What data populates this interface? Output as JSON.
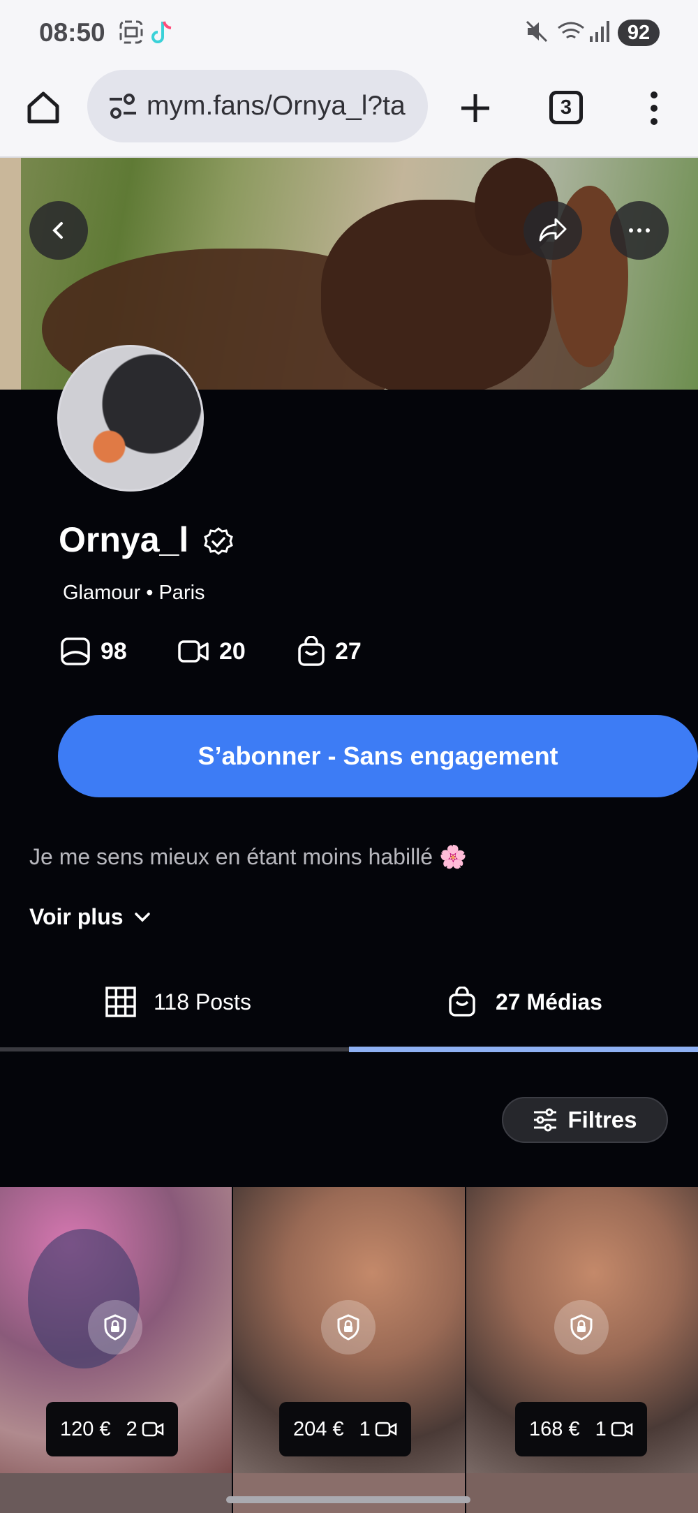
{
  "status_bar": {
    "time": "08:50",
    "battery": "92",
    "icons": [
      "screenshot-icon",
      "tiktok-icon",
      "mute-icon",
      "wifi-icon",
      "signal-icon"
    ]
  },
  "browser": {
    "url": "mym.fans/Ornya_l?ta",
    "tab_count": "3",
    "icons": [
      "home-icon",
      "site-settings-icon",
      "new-tab-icon",
      "tab-switcher-icon",
      "menu-icon"
    ]
  },
  "profile": {
    "username": "Ornya_l",
    "subtitle": "Glamour • Paris",
    "stats": {
      "photos": "98",
      "videos": "20",
      "medias": "27"
    },
    "subscribe_label": "S’abonner - Sans engagement",
    "bio": "Je me sens mieux en étant moins habillé 🌸",
    "more_label": "Voir plus"
  },
  "tabs": [
    {
      "label": "118 Posts",
      "active": false
    },
    {
      "label": "27 Médias",
      "active": true
    }
  ],
  "filters_label": "Filtres",
  "media": [
    {
      "price": "120 €",
      "video_count": "2"
    },
    {
      "price": "204 €",
      "video_count": "1"
    },
    {
      "price": "168 €",
      "video_count": "1"
    }
  ],
  "colors": {
    "accent": "#3d7cf5",
    "tab_indicator": "#8fb1f3",
    "background": "#04050a"
  }
}
